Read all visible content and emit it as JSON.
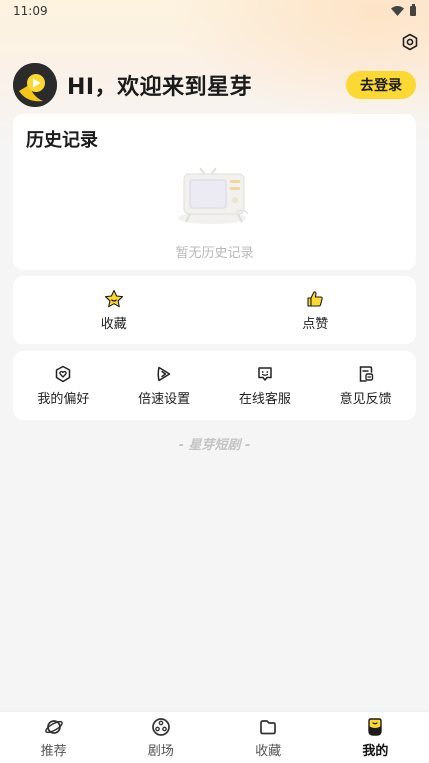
{
  "status_bar": {
    "time": "11:09"
  },
  "profile": {
    "greeting": "HI，欢迎来到星芽",
    "login_label": "去登录"
  },
  "history": {
    "title": "历史记录",
    "empty_text": "暂无历史记录"
  },
  "quick_actions": [
    {
      "label": "收藏",
      "icon": "star-icon"
    },
    {
      "label": "点赞",
      "icon": "thumbs-up-icon"
    }
  ],
  "menu": [
    {
      "label": "我的偏好",
      "icon": "preference-icon"
    },
    {
      "label": "倍速设置",
      "icon": "speed-icon"
    },
    {
      "label": "在线客服",
      "icon": "customer-service-icon"
    },
    {
      "label": "意见反馈",
      "icon": "feedback-icon"
    }
  ],
  "footer_brand": "- 星芽短剧 -",
  "tabs": [
    {
      "label": "推荐",
      "icon": "planet-icon",
      "active": false
    },
    {
      "label": "剧场",
      "icon": "film-reel-icon",
      "active": false
    },
    {
      "label": "收藏",
      "icon": "folder-icon",
      "active": false
    },
    {
      "label": "我的",
      "icon": "profile-icon",
      "active": true
    }
  ],
  "colors": {
    "accent": "#fcd833",
    "background": "#f5f5f5",
    "card": "#ffffff"
  }
}
